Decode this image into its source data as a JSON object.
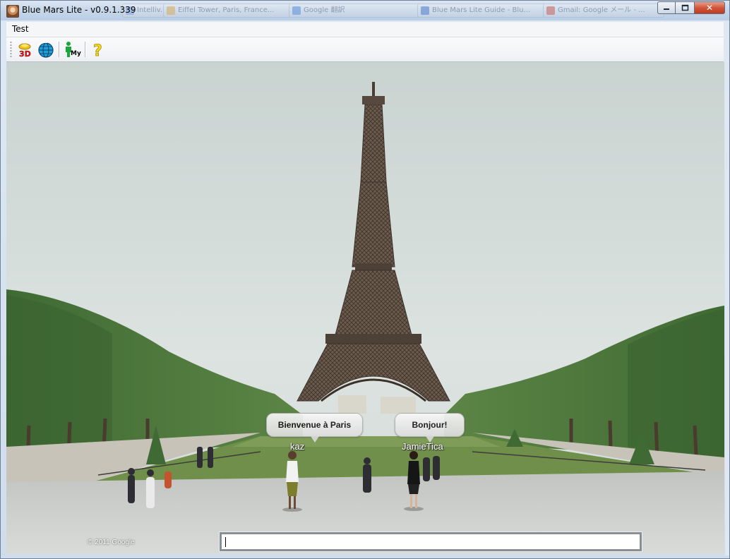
{
  "window": {
    "title": "Blue Mars Lite - v0.9.1.339",
    "background_tabs": [
      "Intelliv...",
      "Eiffel Tower, Paris, France...",
      "Google 翻訳",
      "Blue Mars Lite Guide - Blu...",
      "Gmail: Google メール - ..."
    ],
    "minimize_glyph": "▭",
    "maximize_glyph": "▣",
    "close_glyph": "✕"
  },
  "menu": {
    "items": [
      "Test"
    ]
  },
  "toolbar": {
    "buttons": [
      {
        "icon": "3d-icon",
        "label": "3D"
      },
      {
        "icon": "globe-icon",
        "label": ""
      },
      {
        "icon": "my-avatar-icon",
        "label": "My"
      },
      {
        "icon": "help-icon",
        "label": "?"
      }
    ]
  },
  "scene": {
    "bubbles": [
      {
        "text": "Bienvenue à Paris"
      },
      {
        "text": "Bonjour!"
      }
    ],
    "avatars": [
      {
        "name": "kaz"
      },
      {
        "name": "JamieTica"
      }
    ],
    "copyright": "© 2011 Google"
  },
  "chat": {
    "value": "",
    "placeholder": ""
  },
  "colors": {
    "sky": "#d6dedc",
    "tree": "#4f7a3e",
    "grass": "#6f8f4a",
    "path": "#c9c9c3",
    "tower": "#5b4a3e",
    "close_button": "#c8452a"
  }
}
